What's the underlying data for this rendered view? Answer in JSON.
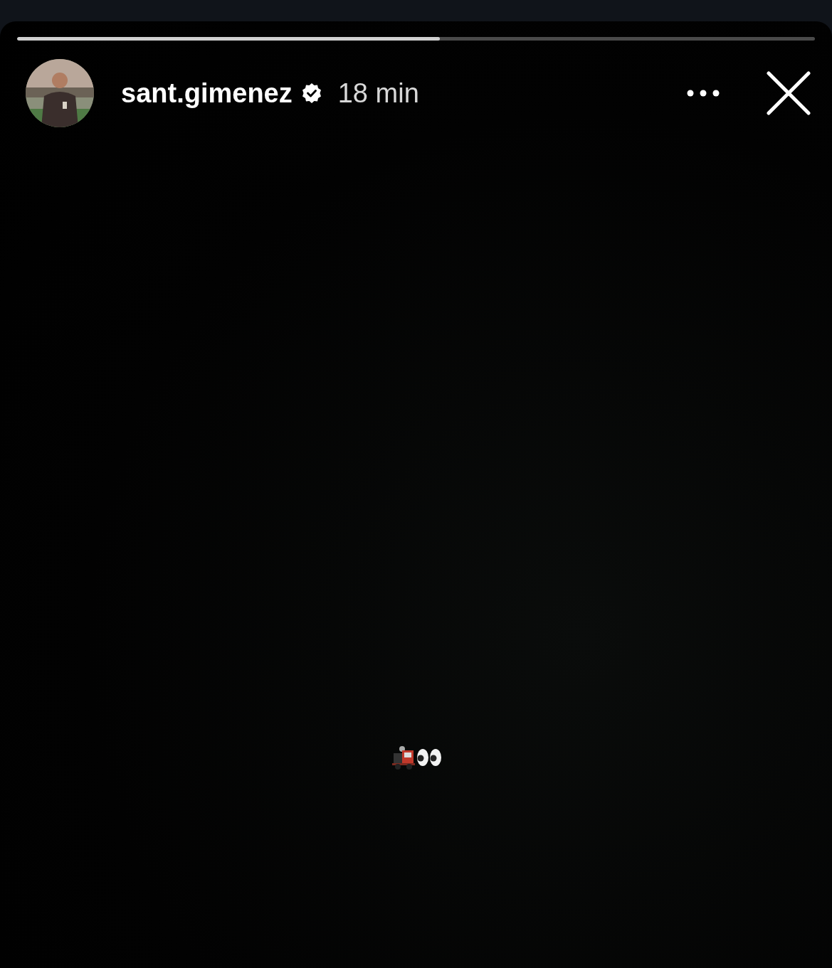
{
  "progress": {
    "level": 0.53
  },
  "header": {
    "username": "sant.gimenez",
    "verified": true,
    "time": "18 min"
  }
}
